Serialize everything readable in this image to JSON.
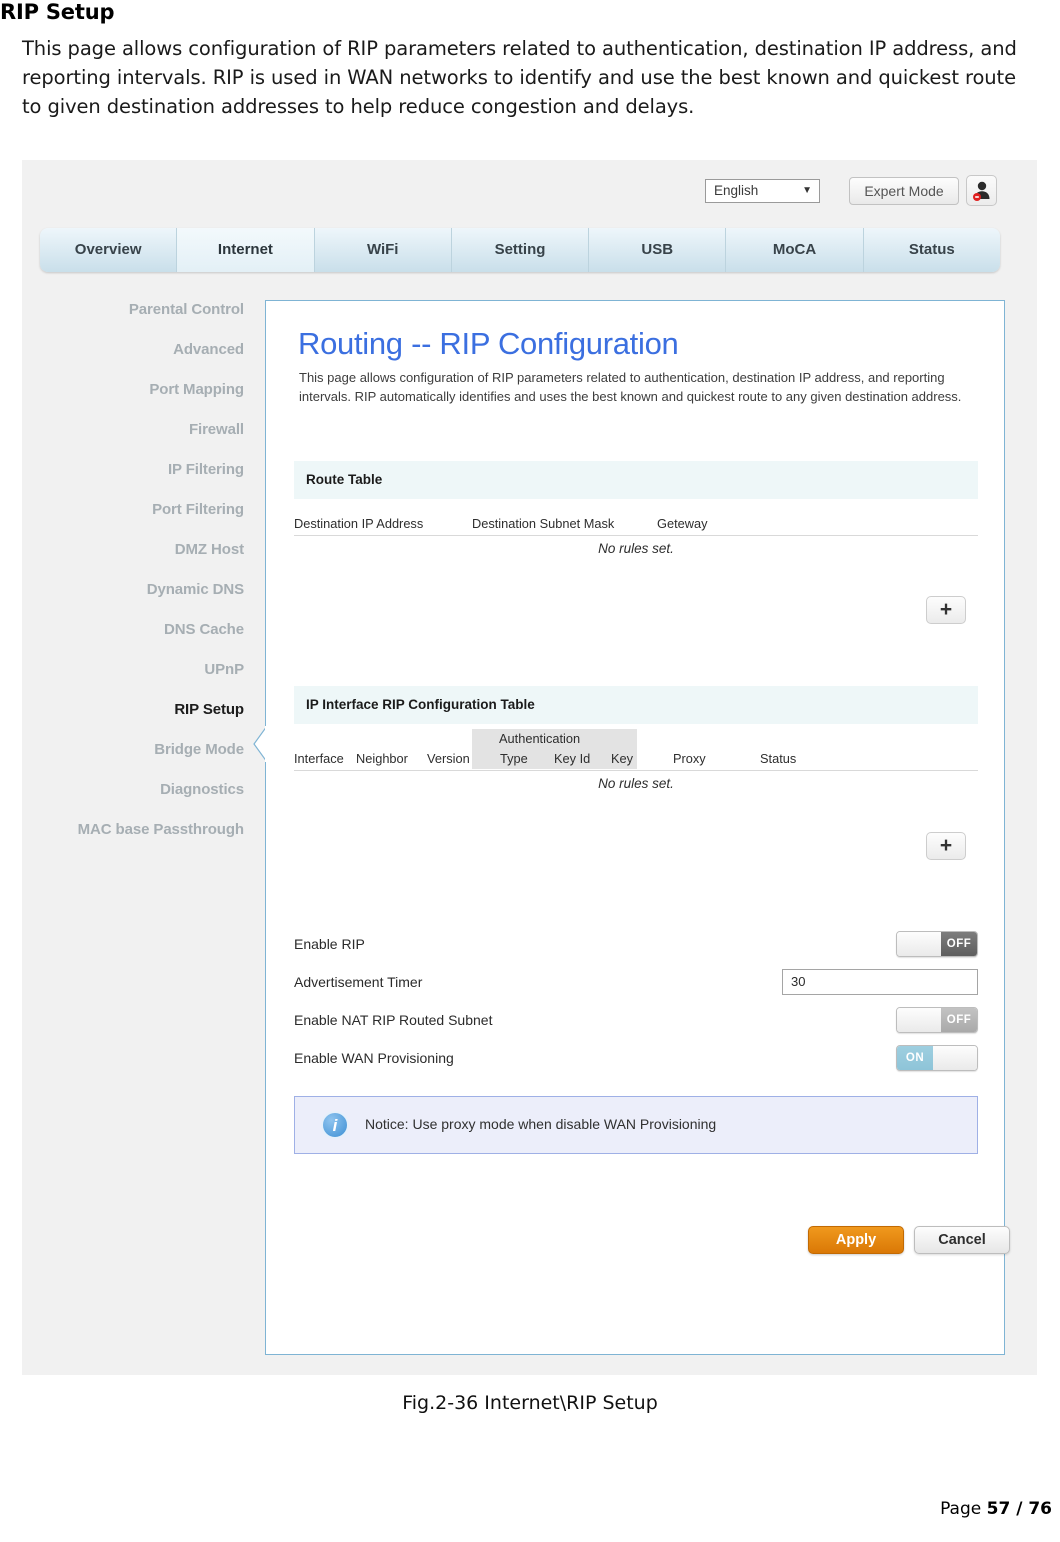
{
  "document": {
    "heading": "RIP Setup",
    "intro": "This page allows configuration of RIP parameters related to authentication, destination IP address, and reporting intervals. RIP is used in WAN networks to identify and use the best known and quickest route to given destination addresses to help reduce congestion and delays.",
    "figure_caption": "Fig.2-36 Internet\\RIP Setup",
    "footer_prefix": "Page ",
    "footer_pages": "57 / 76"
  },
  "topbar": {
    "language": "English",
    "language_caret": "▼",
    "expert_mode": "Expert Mode",
    "user_icon_name": "user-logout-icon"
  },
  "tabs": [
    {
      "label": "Overview",
      "active": false
    },
    {
      "label": "Internet",
      "active": true
    },
    {
      "label": "WiFi",
      "active": false
    },
    {
      "label": "Setting",
      "active": false
    },
    {
      "label": "USB",
      "active": false
    },
    {
      "label": "MoCA",
      "active": false
    },
    {
      "label": "Status",
      "active": false
    }
  ],
  "sidebar": {
    "items": [
      {
        "label": "Parental Control",
        "active": false
      },
      {
        "label": "Advanced",
        "active": false
      },
      {
        "label": "Port Mapping",
        "active": false
      },
      {
        "label": "Firewall",
        "active": false
      },
      {
        "label": "IP Filtering",
        "active": false
      },
      {
        "label": "Port Filtering",
        "active": false
      },
      {
        "label": "DMZ Host",
        "active": false
      },
      {
        "label": "Dynamic DNS",
        "active": false
      },
      {
        "label": "DNS Cache",
        "active": false
      },
      {
        "label": "UPnP",
        "active": false
      },
      {
        "label": "RIP Setup",
        "active": true
      },
      {
        "label": "Bridge Mode",
        "active": false
      },
      {
        "label": "Diagnostics",
        "active": false
      },
      {
        "label": "MAC base Passthrough",
        "active": false
      }
    ]
  },
  "content": {
    "title": "Routing -- RIP Configuration",
    "description": "This page allows configuration of RIP parameters related to authentication, destination IP address, and reporting intervals. RIP automatically identifies and uses the best known and quickest route to any given destination address.",
    "route_table": {
      "section_title": "Route Table",
      "columns": [
        "Destination IP Address",
        "Destination Subnet Mask",
        "Geteway"
      ],
      "empty_text": "No rules set.",
      "add_label": "+"
    },
    "rip_table": {
      "section_title": "IP Interface RIP Configuration Table",
      "group_header": "Authentication",
      "columns": [
        "Interface",
        "Neighbor",
        "Version",
        "Type",
        "Key Id",
        "Key",
        "Proxy",
        "Status"
      ],
      "empty_text": "No rules set.",
      "add_label": "+"
    },
    "settings": [
      {
        "label": "Enable RIP",
        "control": "toggle",
        "state": "OFF",
        "style": "off-dark"
      },
      {
        "label": "Advertisement Timer",
        "control": "input",
        "value": "30"
      },
      {
        "label": "Enable NAT RIP Routed Subnet",
        "control": "toggle",
        "state": "OFF",
        "style": "off-light"
      },
      {
        "label": "Enable WAN Provisioning",
        "control": "toggle",
        "state": "ON",
        "style": "on"
      }
    ],
    "notice": {
      "icon": "info-icon",
      "text": "Notice: Use proxy mode when disable WAN Provisioning"
    },
    "apply_label": "Apply",
    "cancel_label": "Cancel"
  },
  "colors": {
    "accent_blue": "#3b6fe0",
    "panel_border": "#7fb4d4",
    "apply_orange": "#da7806",
    "toggle_on": "#8ec4d8",
    "section_bg": "#eef7f8"
  }
}
